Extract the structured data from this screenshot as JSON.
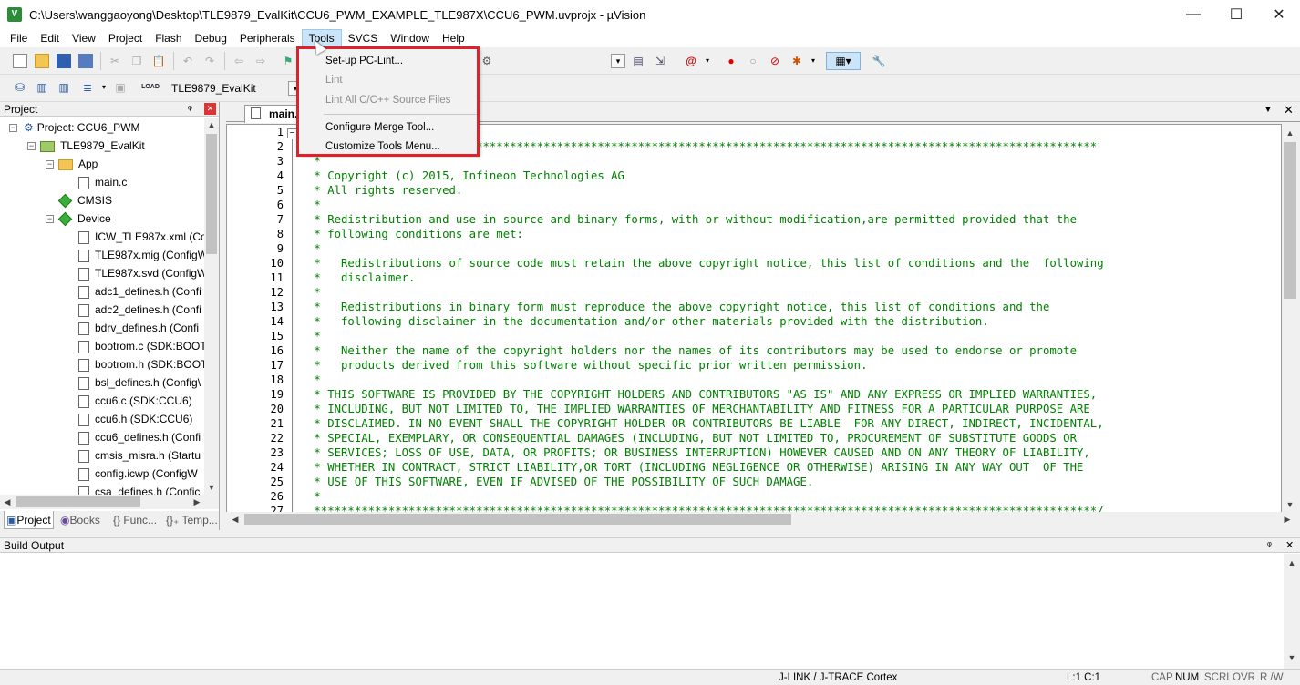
{
  "window": {
    "title": "C:\\Users\\wanggaoyong\\Desktop\\TLE9879_EvalKit\\CCU6_PWM_EXAMPLE_TLE987X\\CCU6_PWM.uvprojx - µVision",
    "minimize": "—",
    "maximize": "☐",
    "close": "✕"
  },
  "menubar": [
    "File",
    "Edit",
    "View",
    "Project",
    "Flash",
    "Debug",
    "Peripherals",
    "Tools",
    "SVCS",
    "Window",
    "Help"
  ],
  "tools_menu": {
    "items": [
      {
        "label": "Set-up PC-Lint...",
        "enabled": true
      },
      {
        "label": "Lint",
        "enabled": false
      },
      {
        "label": "Lint All C/C++ Source Files",
        "enabled": false
      },
      {
        "label": "Configure Merge Tool...",
        "enabled": true
      },
      {
        "label": "Customize Tools Menu...",
        "enabled": true
      }
    ]
  },
  "toolbar2": {
    "target": "TLE9879_EvalKit",
    "load_label": "LOAD"
  },
  "project_panel": {
    "title": "Project",
    "pin": "ᵠ",
    "close": "✕",
    "root": "Project: CCU6_PWM",
    "target": "TLE9879_EvalKit",
    "groups": [
      "App",
      "CMSIS",
      "Device"
    ],
    "app_files": [
      "main.c"
    ],
    "device_files": [
      "ICW_TLE987x.xml (Co",
      "TLE987x.mig (ConfigW",
      "TLE987x.svd (ConfigW",
      "adc1_defines.h (Confi",
      "adc2_defines.h (Confi",
      "bdrv_defines.h (Confi",
      "bootrom.c (SDK:BOOT",
      "bootrom.h (SDK:BOOT",
      "bsl_defines.h (Config\\",
      "ccu6.c (SDK:CCU6)",
      "ccu6.h (SDK:CCU6)",
      "ccu6_defines.h (Confi",
      "cmsis_misra.h (Startu",
      "config.icwp (ConfigW",
      "csa_defines.h (Confic"
    ],
    "bottom_tabs": [
      "Project",
      "Books",
      "{} Func...",
      "{}₊ Temp..."
    ]
  },
  "editor": {
    "tab": "main.c",
    "lines": [
      {
        "n": "1",
        "t": ""
      },
      {
        "n": "2",
        "t": " ********************************************************************************************************************"
      },
      {
        "n": "3",
        "t": " *"
      },
      {
        "n": "4",
        "t": " * Copyright (c) 2015, Infineon Technologies AG"
      },
      {
        "n": "5",
        "t": " * All rights reserved."
      },
      {
        "n": "6",
        "t": " *"
      },
      {
        "n": "7",
        "t": " * Redistribution and use in source and binary forms, with or without modification,are permitted provided that the"
      },
      {
        "n": "8",
        "t": " * following conditions are met:"
      },
      {
        "n": "9",
        "t": " *"
      },
      {
        "n": "10",
        "t": " *   Redistributions of source code must retain the above copyright notice, this list of conditions and the  following"
      },
      {
        "n": "11",
        "t": " *   disclaimer."
      },
      {
        "n": "12",
        "t": " *"
      },
      {
        "n": "13",
        "t": " *   Redistributions in binary form must reproduce the above copyright notice, this list of conditions and the"
      },
      {
        "n": "14",
        "t": " *   following disclaimer in the documentation and/or other materials provided with the distribution."
      },
      {
        "n": "15",
        "t": " *"
      },
      {
        "n": "16",
        "t": " *   Neither the name of the copyright holders nor the names of its contributors may be used to endorse or promote"
      },
      {
        "n": "17",
        "t": " *   products derived from this software without specific prior written permission."
      },
      {
        "n": "18",
        "t": " *"
      },
      {
        "n": "19",
        "t": " * THIS SOFTWARE IS PROVIDED BY THE COPYRIGHT HOLDERS AND CONTRIBUTORS \"AS IS\" AND ANY EXPRESS OR IMPLIED WARRANTIES,"
      },
      {
        "n": "20",
        "t": " * INCLUDING, BUT NOT LIMITED TO, THE IMPLIED WARRANTIES OF MERCHANTABILITY AND FITNESS FOR A PARTICULAR PURPOSE ARE"
      },
      {
        "n": "21",
        "t": " * DISCLAIMED. IN NO EVENT SHALL THE COPYRIGHT HOLDER OR CONTRIBUTORS BE LIABLE  FOR ANY DIRECT, INDIRECT, INCIDENTAL,"
      },
      {
        "n": "22",
        "t": " * SPECIAL, EXEMPLARY, OR CONSEQUENTIAL DAMAGES (INCLUDING, BUT NOT LIMITED TO, PROCUREMENT OF SUBSTITUTE GOODS OR"
      },
      {
        "n": "23",
        "t": " * SERVICES; LOSS OF USE, DATA, OR PROFITS; OR BUSINESS INTERRUPTION) HOWEVER CAUSED AND ON ANY THEORY OF LIABILITY,"
      },
      {
        "n": "24",
        "t": " * WHETHER IN CONTRACT, STRICT LIABILITY,OR TORT (INCLUDING NEGLIGENCE OR OTHERWISE) ARISING IN ANY WAY OUT  OF THE"
      },
      {
        "n": "25",
        "t": " * USE OF THIS SOFTWARE, EVEN IF ADVISED OF THE POSSIBILITY OF SUCH DAMAGE."
      },
      {
        "n": "26",
        "t": " *"
      },
      {
        "n": "27",
        "t": " ********************************************************************************************************************/"
      }
    ]
  },
  "build_output": {
    "title": "Build Output"
  },
  "statusbar": {
    "debugger": "J-LINK / J-TRACE Cortex",
    "position": "L:1 C:1",
    "cap": "CAP",
    "num": "NUM",
    "scrl": "SCRL",
    "ovr": "OVR",
    "rw": "R /W"
  },
  "colors": {
    "highlight": "#e0202a",
    "comment": "#008000"
  }
}
